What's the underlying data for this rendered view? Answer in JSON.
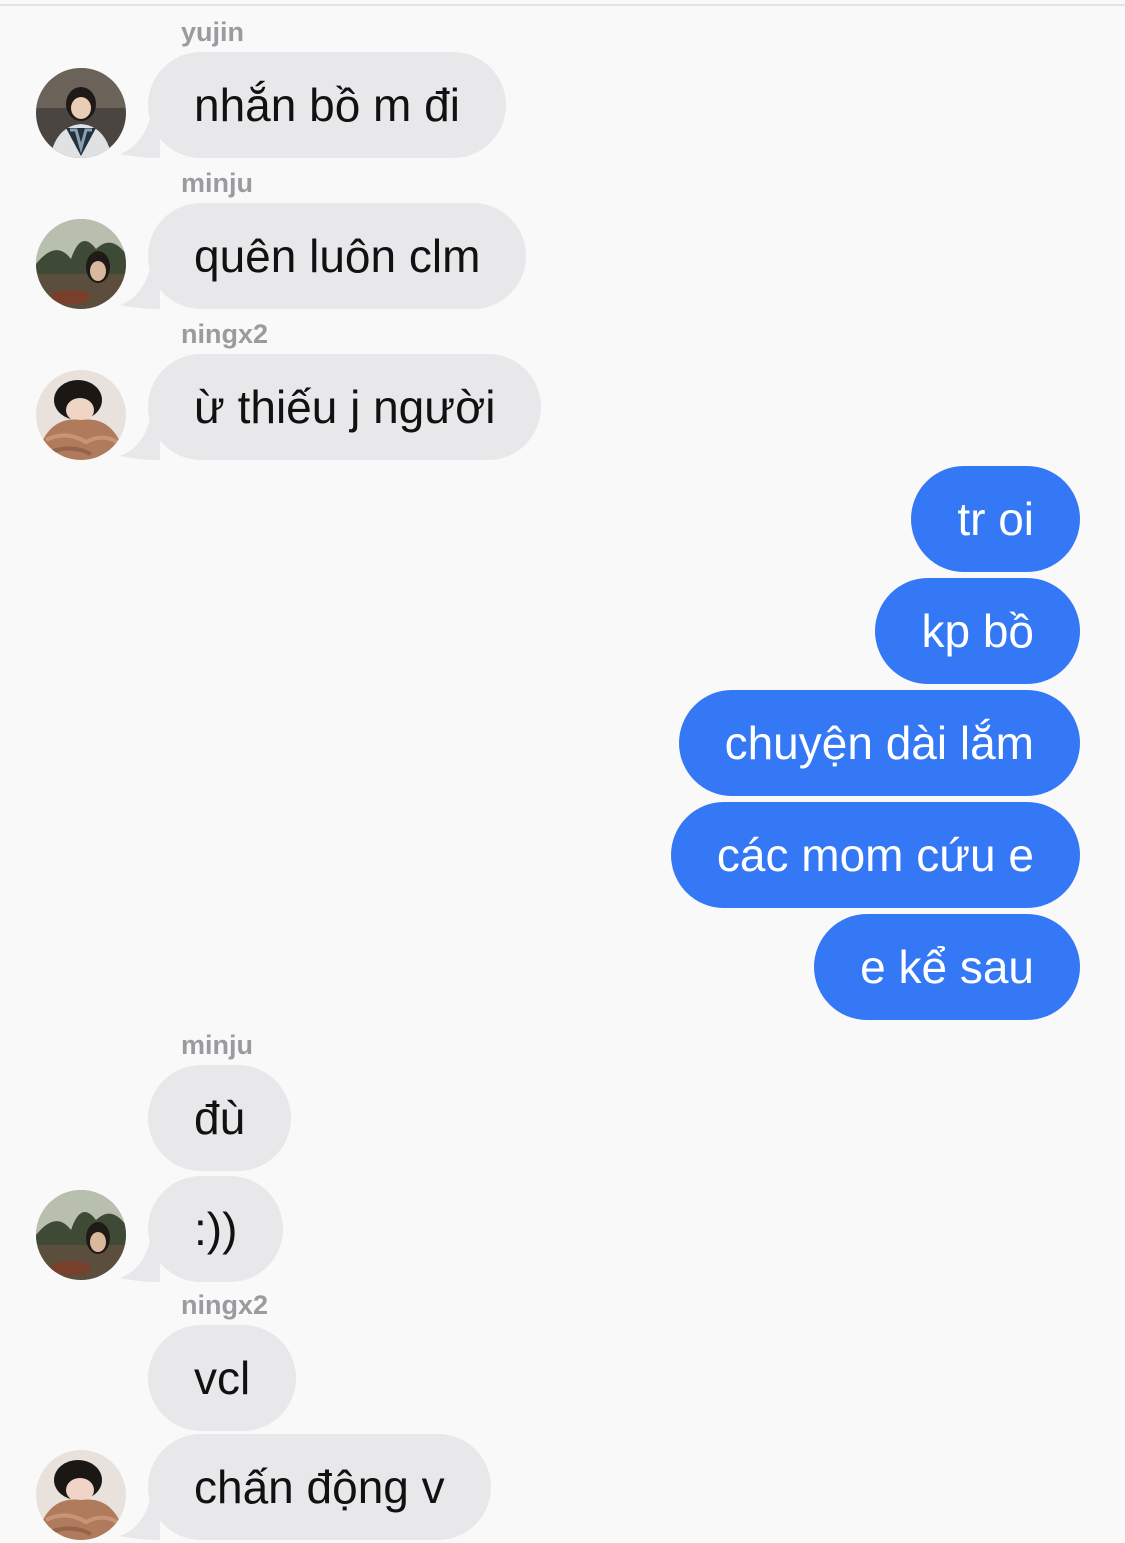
{
  "colors": {
    "background": "#f9f9f9",
    "incoming_bubble": "#e8e8ea",
    "outgoing_bubble": "#3478f6",
    "sender_name": "#9b9b9f"
  },
  "messages": [
    {
      "sender": "yujin",
      "text": "nhắn bồ m đi",
      "avatar": "yujin-avatar"
    },
    {
      "sender": "minju",
      "text": "quên luôn clm",
      "avatar": "minju-avatar"
    },
    {
      "sender": "ningx2",
      "text": "ừ thiếu j người",
      "avatar": "ningx2-avatar"
    },
    {
      "text": "tr oi"
    },
    {
      "text": "kp bồ"
    },
    {
      "text": "chuyện dài lắm"
    },
    {
      "text": "các mom cứu e"
    },
    {
      "text": "e kể sau"
    },
    {
      "sender": "minju",
      "text": "đù"
    },
    {
      "text": ":))",
      "avatar": "minju-avatar"
    },
    {
      "sender": "ningx2",
      "text": "vcl"
    },
    {
      "text": "chấn động v",
      "avatar": "ningx2-avatar"
    }
  ]
}
